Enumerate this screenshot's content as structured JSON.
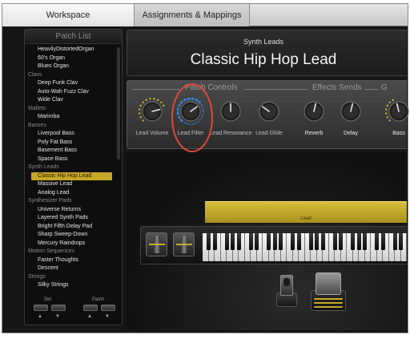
{
  "tabs": [
    {
      "label": "Workspace",
      "active": true
    },
    {
      "label": "Assignments & Mappings",
      "active": false
    }
  ],
  "patch_list": {
    "header": "Patch List",
    "rows": [
      {
        "type": "patch",
        "label": "HeavilyDistortedOrgan"
      },
      {
        "type": "patch",
        "label": "60's Organ"
      },
      {
        "type": "patch",
        "label": "Blues Organ"
      },
      {
        "type": "category",
        "label": "Clavs"
      },
      {
        "type": "patch",
        "label": "Deep Funk Clav"
      },
      {
        "type": "patch",
        "label": "Auto-Wah Fuzz Clav"
      },
      {
        "type": "patch",
        "label": "Wide Clav"
      },
      {
        "type": "category",
        "label": "Mallets"
      },
      {
        "type": "patch",
        "label": "Marimba"
      },
      {
        "type": "category",
        "label": "Basses"
      },
      {
        "type": "patch",
        "label": "Liverpool Bass"
      },
      {
        "type": "patch",
        "label": "Poly Fat Bass"
      },
      {
        "type": "patch",
        "label": "Basement Bass"
      },
      {
        "type": "patch",
        "label": "Space Bass"
      },
      {
        "type": "category",
        "label": "Synth Leads"
      },
      {
        "type": "patch",
        "label": "Classic Hip Hop Lead",
        "selected": true
      },
      {
        "type": "patch",
        "label": "Massive Lead"
      },
      {
        "type": "patch",
        "label": "Analog Lead"
      },
      {
        "type": "category",
        "label": "Synthesizer Pads"
      },
      {
        "type": "patch",
        "label": "Universe Returns"
      },
      {
        "type": "patch",
        "label": "Layered Synth Pads"
      },
      {
        "type": "patch",
        "label": "Bright Fifth Delay Pad"
      },
      {
        "type": "patch",
        "label": "Sharp Sweep-Down"
      },
      {
        "type": "patch",
        "label": "Mercury Raindrops"
      },
      {
        "type": "category",
        "label": "Motion Sequences"
      },
      {
        "type": "patch",
        "label": "Faster Thoughts"
      },
      {
        "type": "patch",
        "label": "Descent"
      },
      {
        "type": "category",
        "label": "Strings"
      },
      {
        "type": "patch",
        "label": "Silky Strings"
      }
    ],
    "footer": {
      "set_label": "Set",
      "patch_label": "Patch"
    }
  },
  "header_panel": {
    "category": "Synth Leads",
    "patch_name": "Classic Hip Hop Lead"
  },
  "sections": {
    "patch_controls": "Patch Controls",
    "effects_sends": "Effects Sends",
    "g": "G"
  },
  "knobs": [
    {
      "label": "Lead Volume",
      "value": 0.78,
      "ring": "yellow"
    },
    {
      "label": "Lead Filter",
      "value": 0.7,
      "ring": "blue"
    },
    {
      "label": "Lead Resonance",
      "value": 0.5,
      "ring": "none"
    },
    {
      "label": "Lead Glide",
      "value": 0.3,
      "ring": "none"
    },
    {
      "label": "Reverb",
      "value": 0.55,
      "ring": "none"
    },
    {
      "label": "Delay",
      "value": 0.55,
      "ring": "none"
    },
    {
      "label": "Bass",
      "value": 0.45,
      "ring": "yellow"
    }
  ],
  "keyboard": {
    "layer_label": "Lead"
  },
  "colors": {
    "accent": "#c6a728",
    "highlight": "#e2483c",
    "active_ring": "#3a7fd8"
  }
}
